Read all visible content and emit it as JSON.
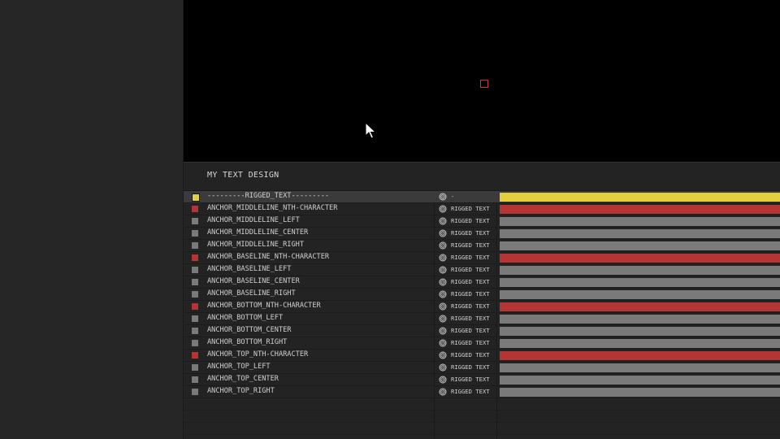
{
  "composition": {
    "title": "MY TEXT DESIGN"
  },
  "colors": {
    "yellow": "#e3cf3d",
    "red": "#b53535",
    "gray": "#7a7a7a"
  },
  "layers": [
    {
      "name": "---------RIGGED_TEXT---------",
      "parent": "-",
      "color": "yellow",
      "selected": true
    },
    {
      "name": "ANCHOR_MIDDLELINE_NTH-CHARACTER",
      "parent": "RIGGED TEXT",
      "color": "red"
    },
    {
      "name": "ANCHOR_MIDDLELINE_LEFT",
      "parent": "RIGGED TEXT",
      "color": "gray"
    },
    {
      "name": "ANCHOR_MIDDLELINE_CENTER",
      "parent": "RIGGED TEXT",
      "color": "gray"
    },
    {
      "name": "ANCHOR_MIDDLELINE_RIGHT",
      "parent": "RIGGED TEXT",
      "color": "gray"
    },
    {
      "name": "ANCHOR_BASELINE_NTH-CHARACTER",
      "parent": "RIGGED TEXT",
      "color": "red"
    },
    {
      "name": "ANCHOR_BASELINE_LEFT",
      "parent": "RIGGED TEXT",
      "color": "gray"
    },
    {
      "name": "ANCHOR_BASELINE_CENTER",
      "parent": "RIGGED TEXT",
      "color": "gray"
    },
    {
      "name": "ANCHOR_BASELINE_RIGHT",
      "parent": "RIGGED TEXT",
      "color": "gray"
    },
    {
      "name": "ANCHOR_BOTTOM_NTH-CHARACTER",
      "parent": "RIGGED TEXT",
      "color": "red"
    },
    {
      "name": "ANCHOR_BOTTOM_LEFT",
      "parent": "RIGGED TEXT",
      "color": "gray"
    },
    {
      "name": "ANCHOR_BOTTOM_CENTER",
      "parent": "RIGGED TEXT",
      "color": "gray"
    },
    {
      "name": "ANCHOR_BOTTOM_RIGHT",
      "parent": "RIGGED TEXT",
      "color": "gray"
    },
    {
      "name": "ANCHOR_TOP_NTH-CHARACTER",
      "parent": "RIGGED TEXT",
      "color": "red"
    },
    {
      "name": "ANCHOR_TOP_LEFT",
      "parent": "RIGGED TEXT",
      "color": "gray"
    },
    {
      "name": "ANCHOR_TOP_CENTER",
      "parent": "RIGGED TEXT",
      "color": "gray"
    },
    {
      "name": "ANCHOR_TOP_RIGHT",
      "parent": "RIGGED TEXT",
      "color": "gray"
    }
  ],
  "icons": {
    "pickwhip": "pickwhip-icon",
    "cursor": "mouse-cursor-icon",
    "anchor": "anchor-point-marker"
  }
}
